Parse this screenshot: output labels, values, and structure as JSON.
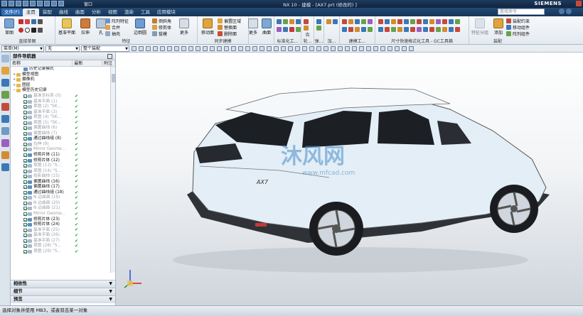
{
  "titlebar": {
    "qat_label": "窗口",
    "title": "NX 10 - 建模 - [AX7.prt  (修改的) ]",
    "brand": "SIEMENS"
  },
  "tabs": {
    "file": "文件(F)",
    "items": [
      "主页",
      "装配",
      "曲线",
      "曲面",
      "分析",
      "视图",
      "渲染",
      "工具",
      "应用模块"
    ],
    "search_placeholder": "查找命令"
  },
  "ribbon": {
    "groups": {
      "direct_sketch": "直接草图",
      "feature": "特征",
      "sync_modeling": "同步建模",
      "standard": "标准化工...",
      "gear": "齿轮...",
      "spring": "弹...",
      "mold": "加...",
      "build": "建模工...",
      "dim_quick": "尺寸快速格式化工具 - GC工具箱",
      "assembly": "装配"
    },
    "buttons": {
      "sketch": "草图",
      "datum_plane": "基准平面",
      "extrude": "拉伸",
      "hole": "孔",
      "array_feature": "阵列特征",
      "unite": "合并",
      "shell": "抽壳",
      "edge_blend": "边倒圆",
      "chamfer": "倒斜角",
      "trim_body": "修剪体",
      "draft": "拔模",
      "more1": "更多",
      "move_face": "移动面",
      "offset_region": "偏置区域",
      "replace_face": "替换面",
      "delete_face": "删除面",
      "more2": "更多",
      "surface": "曲面",
      "feature_group": "特征分组",
      "add": "添加",
      "assembly_constraint": "装配约束",
      "move_component": "移动组件",
      "pattern_component": "阵列组件"
    }
  },
  "selbar": {
    "filter": "菜单(M)",
    "filter_value": "无",
    "scope": "整个装配"
  },
  "navigator": {
    "title": "部件导航器",
    "columns": [
      "名称",
      "最新",
      "附注"
    ],
    "rows": [
      {
        "label": "历史记录模式",
        "dim": false,
        "check": false,
        "ok": false,
        "indent": 1
      },
      {
        "label": "模型视图",
        "dim": false,
        "check": false,
        "ok": false,
        "indent": 0
      },
      {
        "label": "摄像机",
        "dim": false,
        "check": false,
        "ok": false,
        "indent": 0
      },
      {
        "label": "图层",
        "dim": false,
        "check": false,
        "ok": false,
        "indent": 0
      },
      {
        "label": "模型历史记录",
        "dim": false,
        "check": false,
        "ok": false,
        "indent": 0
      },
      {
        "label": "基准坐标系 (0)",
        "dim": true,
        "check": true,
        "ok": true,
        "indent": 1
      },
      {
        "label": "基准平面 (1)",
        "dim": true,
        "check": true,
        "ok": true,
        "indent": 1
      },
      {
        "label": "草图 (2) \"SK...",
        "dim": true,
        "check": true,
        "ok": true,
        "indent": 1
      },
      {
        "label": "基准平面 (3)",
        "dim": true,
        "check": true,
        "ok": true,
        "indent": 1
      },
      {
        "label": "草图 (4) \"SK...",
        "dim": true,
        "check": true,
        "ok": true,
        "indent": 1
      },
      {
        "label": "草图 (5) \"SK...",
        "dim": true,
        "check": true,
        "ok": true,
        "indent": 1
      },
      {
        "label": "偏置曲线 (6)",
        "dim": true,
        "check": true,
        "ok": true,
        "indent": 1
      },
      {
        "label": "偏置曲线 (7)",
        "dim": true,
        "check": true,
        "ok": true,
        "indent": 1
      },
      {
        "label": "通过曲线组 (8)",
        "dim": false,
        "check": true,
        "ok": true,
        "indent": 1
      },
      {
        "label": "拉伸 (9)",
        "dim": true,
        "check": true,
        "ok": true,
        "indent": 1
      },
      {
        "label": "Mirror Geome...",
        "dim": true,
        "check": true,
        "ok": true,
        "indent": 1
      },
      {
        "label": "修剪片体 (11)",
        "dim": false,
        "check": true,
        "ok": true,
        "indent": 1
      },
      {
        "label": "修剪片体 (12)",
        "dim": false,
        "check": true,
        "ok": true,
        "indent": 1
      },
      {
        "label": "草图 (13) \"S...",
        "dim": true,
        "check": true,
        "ok": true,
        "indent": 1
      },
      {
        "label": "草图 (14) \"S...",
        "dim": true,
        "check": true,
        "ok": true,
        "indent": 1
      },
      {
        "label": "投影曲线 (15)",
        "dim": true,
        "check": true,
        "ok": true,
        "indent": 1
      },
      {
        "label": "偏置曲线 (16)",
        "dim": false,
        "check": true,
        "ok": true,
        "indent": 1
      },
      {
        "label": "偏置曲线 (17)",
        "dim": false,
        "check": true,
        "ok": true,
        "indent": 1
      },
      {
        "label": "通过曲线组 (18)",
        "dim": false,
        "check": true,
        "ok": true,
        "indent": 1
      },
      {
        "label": "N 边曲面 (19)",
        "dim": true,
        "check": true,
        "ok": true,
        "indent": 1
      },
      {
        "label": "N 边曲面 (20)",
        "dim": true,
        "check": true,
        "ok": true,
        "indent": 1
      },
      {
        "label": "N 边曲面 (21)",
        "dim": true,
        "check": true,
        "ok": true,
        "indent": 1
      },
      {
        "label": "Mirror Geome...",
        "dim": true,
        "check": true,
        "ok": true,
        "indent": 1
      },
      {
        "label": "修剪片体 (23)",
        "dim": false,
        "check": true,
        "ok": true,
        "indent": 1
      },
      {
        "label": "修剪片体 (24)",
        "dim": false,
        "check": true,
        "ok": true,
        "indent": 1
      },
      {
        "label": "基准平面 (25)",
        "dim": true,
        "check": true,
        "ok": true,
        "indent": 1
      },
      {
        "label": "基准平面 (26)",
        "dim": true,
        "check": true,
        "ok": true,
        "indent": 1
      },
      {
        "label": "基准平面 (27)",
        "dim": true,
        "check": true,
        "ok": true,
        "indent": 1
      },
      {
        "label": "草图 (28) \"S...",
        "dim": true,
        "check": true,
        "ok": true,
        "indent": 1
      },
      {
        "label": "草图 (29) \"S...",
        "dim": true,
        "check": true,
        "ok": true,
        "indent": 1
      }
    ],
    "panels": [
      "相依性",
      "细节",
      "预览"
    ]
  },
  "viewport": {
    "model_badge": "AX7",
    "watermark": "沐风网",
    "watermark_url": "www.mfcad.com"
  },
  "status": "选择对象并使用 MB3，或者双击某一对象"
}
